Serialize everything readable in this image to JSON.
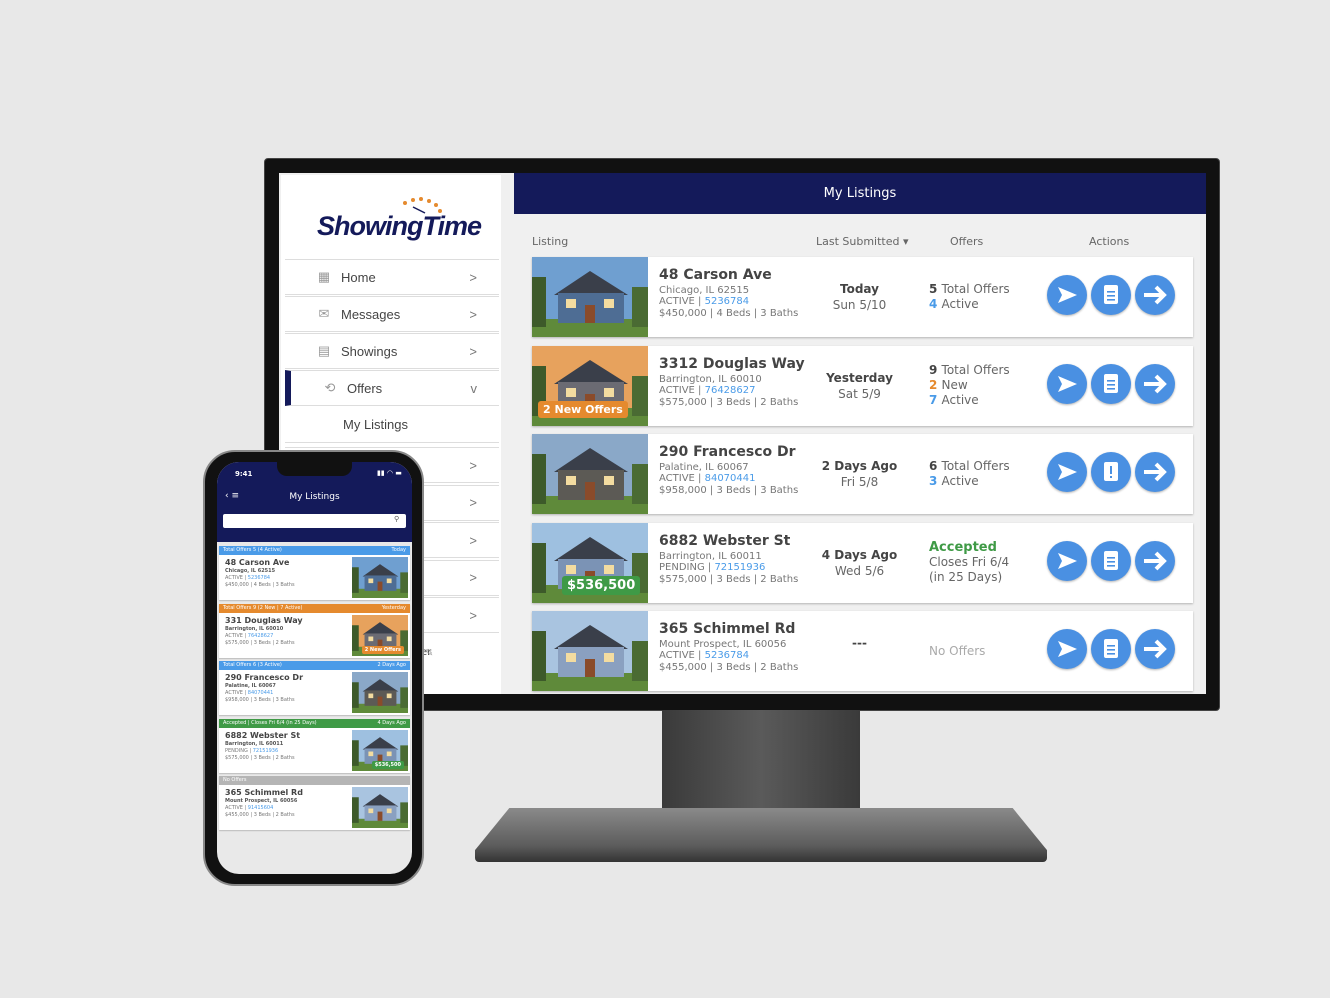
{
  "app": {
    "brand": "ShowingTime",
    "header_title": "My Listings"
  },
  "sidebar": {
    "items": [
      {
        "label": "Home",
        "icon": "dashboard-icon",
        "chevron": ">"
      },
      {
        "label": "Messages",
        "icon": "envelope-icon",
        "chevron": ">"
      },
      {
        "label": "Showings",
        "icon": "calendar-icon",
        "chevron": ">"
      },
      {
        "label": "Offers",
        "icon": "offers-icon",
        "chevron": "v",
        "selected": true
      }
    ],
    "sub_item": "My Listings",
    "hidden_chevrons": [
      ">",
      ">",
      ">",
      ">",
      ">"
    ],
    "partial_label": "er"
  },
  "columns": {
    "listing": "Listing",
    "last_submitted": "Last Submitted",
    "offers": "Offers",
    "actions": "Actions"
  },
  "listings": [
    {
      "address": "48 Carson Ave",
      "city": "Chicago, IL 62515",
      "status": "ACTIVE",
      "mls": "5236784",
      "details": "$450,000 | 4 Beds | 3 Baths",
      "when": "Today",
      "date": "Sun 5/10",
      "offers": [
        {
          "n": "5",
          "t": "Total Offers",
          "c": "plain"
        },
        {
          "n": "4",
          "t": "Active",
          "c": "blue"
        }
      ],
      "badge": null,
      "clip": "list"
    },
    {
      "address": "3312 Douglas Way",
      "city": "Barrington, IL 60010",
      "status": "ACTIVE",
      "mls": "76428627",
      "details": "$575,000 | 3 Beds | 2 Baths",
      "when": "Yesterday",
      "date": "Sat 5/9",
      "offers": [
        {
          "n": "9",
          "t": "Total Offers",
          "c": "plain"
        },
        {
          "n": "2",
          "t": "New",
          "c": "orange"
        },
        {
          "n": "7",
          "t": "Active",
          "c": "blue"
        }
      ],
      "badge": {
        "text": "2 New Offers",
        "color": "#e58a2e"
      },
      "clip": "list"
    },
    {
      "address": "290 Francesco Dr",
      "city": "Palatine, IL 60067",
      "status": "ACTIVE",
      "mls": "84070441",
      "details": "$958,000 | 3 Beds | 3 Baths",
      "when": "2 Days Ago",
      "date": "Fri 5/8",
      "offers": [
        {
          "n": "6",
          "t": "Total Offers",
          "c": "plain"
        },
        {
          "n": "3",
          "t": "Active",
          "c": "blue"
        }
      ],
      "badge": null,
      "clip": "alert"
    },
    {
      "address": "6882 Webster St",
      "city": "Barrington, IL 60011",
      "status": "PENDING",
      "mls": "72151936",
      "details": "$575,000 | 3 Beds | 2 Baths",
      "when": "4 Days Ago",
      "date": "Wed 5/6",
      "offers": [
        {
          "n": "Accepted",
          "t": "",
          "c": "green"
        },
        {
          "n": "",
          "t": "Closes Fri 6/4",
          "c": "plain"
        },
        {
          "n": "",
          "t": "(in 25 Days)",
          "c": "plain"
        }
      ],
      "badge": {
        "text": "$536,500",
        "color": "#3f9a46"
      },
      "clip": "list"
    },
    {
      "address": "365 Schimmel Rd",
      "city": "Mount Prospect, IL 60056",
      "status": "ACTIVE",
      "mls": "5236784",
      "details": "$455,000 | 3 Beds | 2 Baths",
      "when": "---",
      "date": "",
      "offers": [
        {
          "n": "",
          "t": "No Offers",
          "c": "muted"
        }
      ],
      "badge": null,
      "clip": "list"
    }
  ],
  "phone": {
    "time": "9:41",
    "title": "My Listings",
    "search_placeholder": "",
    "cards": [
      {
        "bar_left": "Total Offers 5 (4 Active)",
        "bar_right": "Today",
        "color": "#4a9be8",
        "address": "48 Carson Ave",
        "city": "Chicago, IL 62515",
        "status": "ACTIVE",
        "mls": "5236784",
        "details": "$450,000 | 4 Beds | 3 Baths",
        "badge": null
      },
      {
        "bar_left": "Total Offers 9 (2 New | 7 Active)",
        "bar_right": "Yesterday",
        "color": "#e58a2e",
        "address": "331 Douglas Way",
        "city": "Barrington, IL 60010",
        "status": "ACTIVE",
        "mls": "76428627",
        "details": "$575,000 | 3 Beds | 2 Baths",
        "badge": {
          "text": "2 New Offers",
          "color": "#e58a2e"
        }
      },
      {
        "bar_left": "Total Offers 6 (3 Active)",
        "bar_right": "2 Days Ago",
        "color": "#4a9be8",
        "address": "290 Francesco Dr",
        "city": "Palatine, IL 60067",
        "status": "ACTIVE",
        "mls": "84070441",
        "details": "$958,000 | 3 Beds | 3 Baths",
        "badge": null
      },
      {
        "bar_left": "Accepted | Closes Fri 6/4 (in 25 Days)",
        "bar_right": "4 Days Ago",
        "color": "#3f9a46",
        "address": "6882 Webster St",
        "city": "Barrington, IL 60011",
        "status": "PENDING",
        "mls": "72151936",
        "details": "$575,000 | 3 Beds | 2 Baths",
        "badge": {
          "text": "$536,500",
          "color": "#3f9a46"
        }
      },
      {
        "bar_left": "No Offers",
        "bar_right": "",
        "color": "#b5b5b5",
        "address": "365 Schimmel Rd",
        "city": "Mount Prospect, IL 60056",
        "status": "ACTIVE",
        "mls": "91415604",
        "details": "$455,000 | 3 Beds | 2 Baths",
        "badge": null
      }
    ]
  },
  "colors": {
    "navy": "#141a5a",
    "accent_blue": "#4a90e2",
    "orange": "#e58a2e",
    "green": "#3f9a46"
  }
}
